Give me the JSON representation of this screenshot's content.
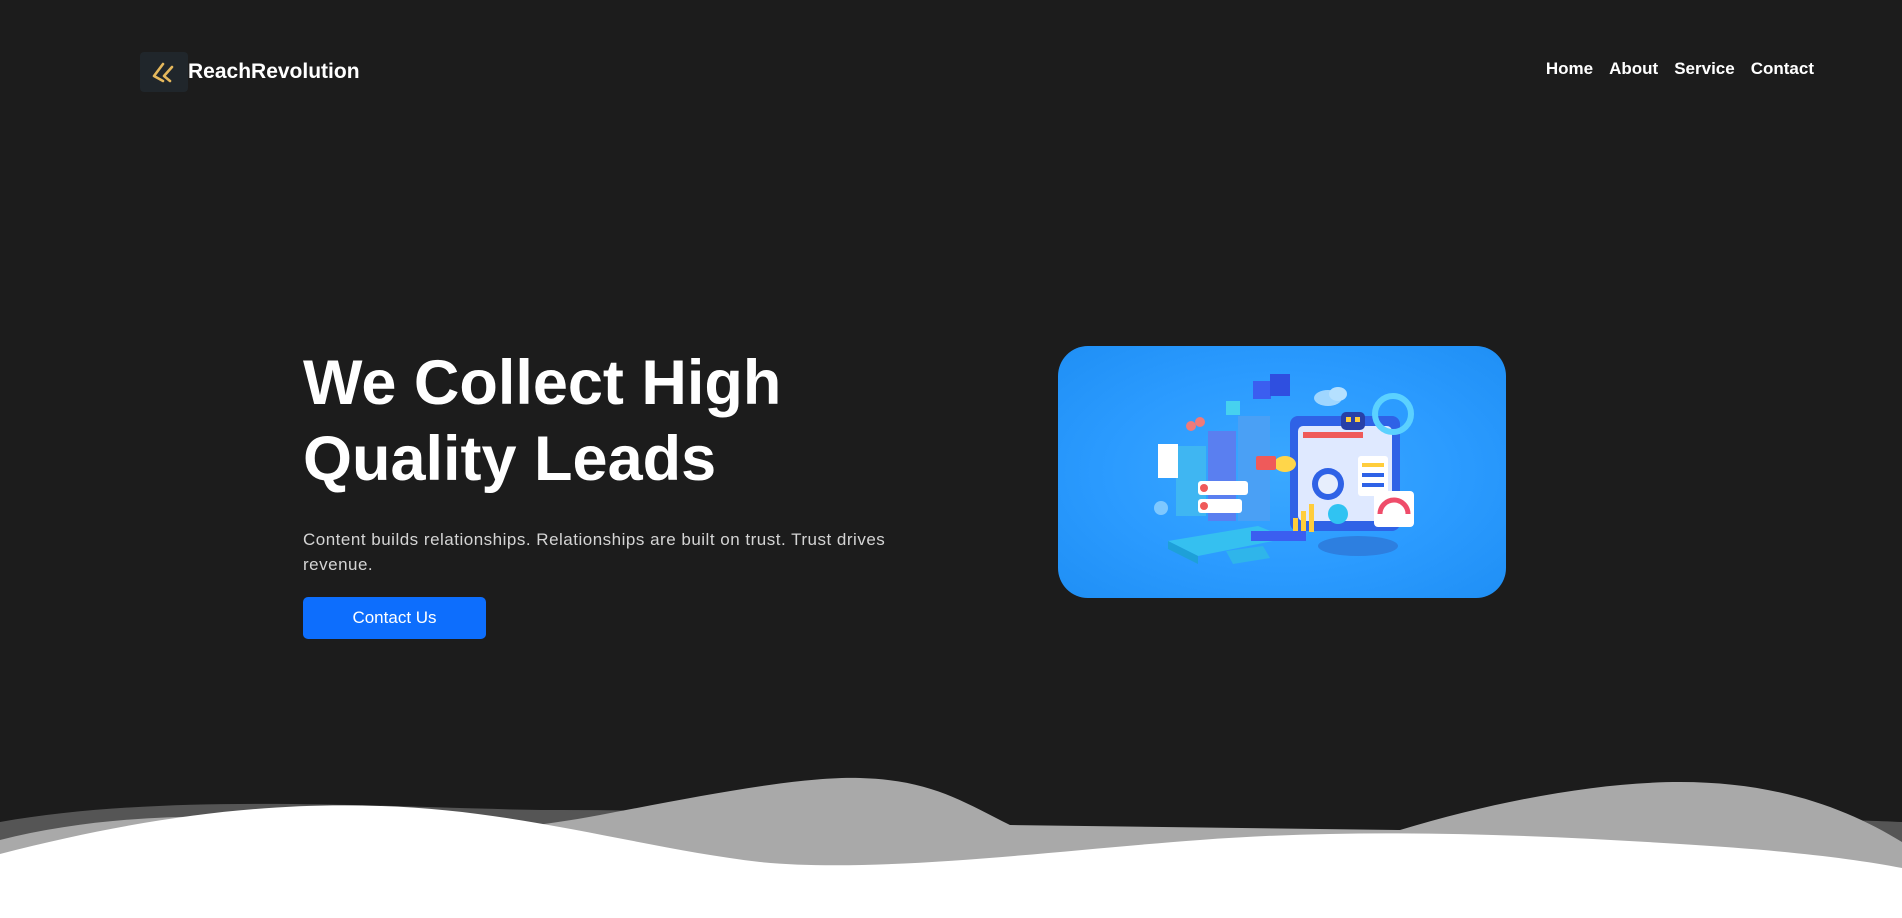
{
  "brand": {
    "name": "ReachRevolution",
    "logo_icon": "double-chevron-left-icon",
    "accent": "#e5b85c"
  },
  "nav": {
    "items": [
      {
        "label": "Home"
      },
      {
        "label": "About"
      },
      {
        "label": "Service"
      },
      {
        "label": "Contact"
      }
    ]
  },
  "hero": {
    "title_line1": "We Collect High",
    "title_line2": "Quality Leads",
    "subtitle": "Content builds relationships. Relationships are built on trust. Trust drives revenue.",
    "cta_label": "Contact Us",
    "cta_color": "#0d6efd",
    "image_icon": "digital-marketing-illustration"
  },
  "theme": {
    "background": "#1c1c1c",
    "wave_colors": [
      "#555555",
      "#a9a9a9",
      "#ffffff"
    ]
  }
}
